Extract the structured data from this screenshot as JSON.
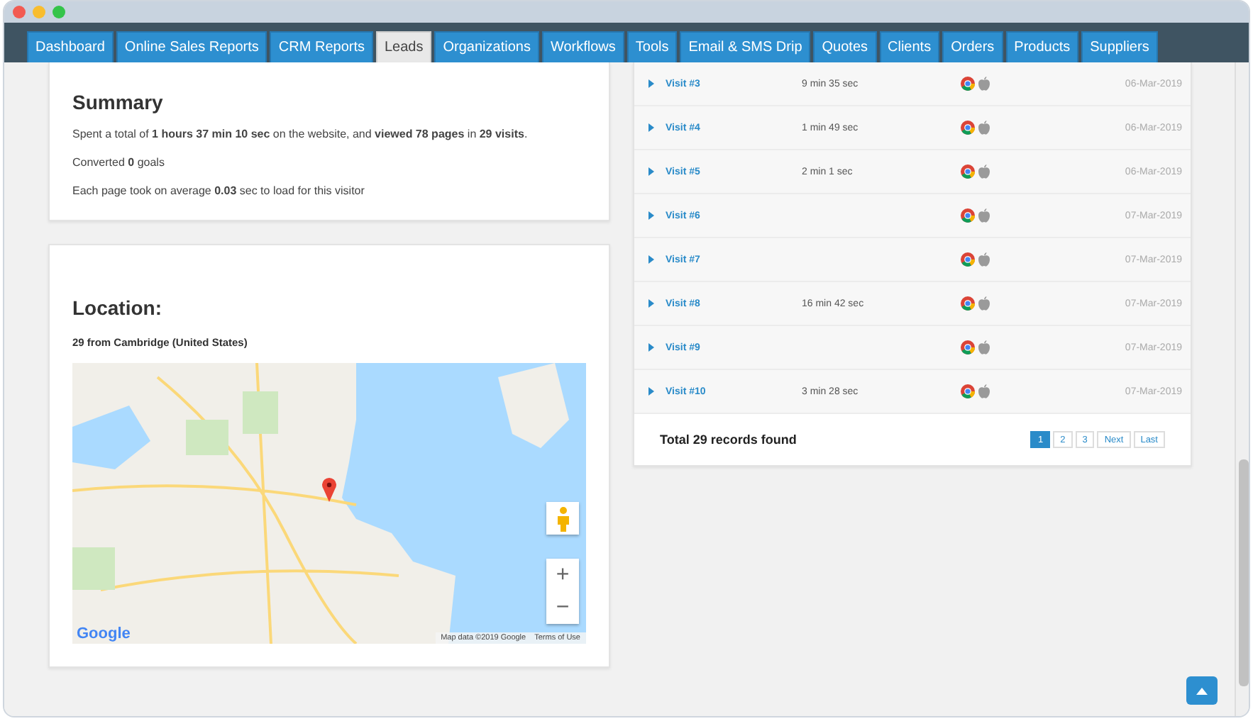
{
  "tabs": [
    {
      "label": "Dashboard",
      "selected": false
    },
    {
      "label": "Online Sales Reports",
      "selected": false
    },
    {
      "label": "CRM Reports",
      "selected": false
    },
    {
      "label": "Leads",
      "selected": true
    },
    {
      "label": "Organizations",
      "selected": false
    },
    {
      "label": "Workflows",
      "selected": false
    },
    {
      "label": "Tools",
      "selected": false
    },
    {
      "label": "Email & SMS Drip",
      "selected": false
    },
    {
      "label": "Quotes",
      "selected": false
    },
    {
      "label": "Clients",
      "selected": false
    },
    {
      "label": "Orders",
      "selected": false
    },
    {
      "label": "Products",
      "selected": false
    },
    {
      "label": "Suppliers",
      "selected": false
    }
  ],
  "summary": {
    "title": "Summary",
    "lines": [
      "Spent a total of **1 hours 37 min 10 sec** on the website, and **viewed 78 pages** in **29 visits**.",
      "Converted **0** goals",
      "Each page took on average **0.03** sec to load for this visitor"
    ]
  },
  "location": {
    "title": "Location:",
    "place": "29 from Cambridge (United States)",
    "map": {
      "logo": "Google",
      "attribution": "Map data ©2019 Google",
      "terms": "Terms of Use",
      "zoom_in": "+",
      "zoom_out": "−"
    }
  },
  "visits": {
    "rows": [
      {
        "label": "Visit #3",
        "duration": "9 min 35 sec",
        "date": "06-Mar-2019"
      },
      {
        "label": "Visit #4",
        "duration": "1 min 49 sec",
        "date": "06-Mar-2019"
      },
      {
        "label": "Visit #5",
        "duration": "2 min 1 sec",
        "date": "06-Mar-2019"
      },
      {
        "label": "Visit #6",
        "date": "07-Mar-2019"
      },
      {
        "label": "Visit #7",
        "date": "07-Mar-2019"
      },
      {
        "label": "Visit #8",
        "duration": "16 min 42 sec",
        "date": "07-Mar-2019"
      },
      {
        "label": "Visit #9",
        "date": "07-Mar-2019"
      },
      {
        "label": "Visit #10",
        "duration": "3 min 28 sec",
        "date": "07-Mar-2019"
      }
    ],
    "total": "Total 29 records found",
    "pages": [
      {
        "label": "1",
        "selected": true
      },
      {
        "label": "2",
        "selected": false
      },
      {
        "label": "3",
        "selected": false
      },
      {
        "label": "Next",
        "selected": false
      },
      {
        "label": "Last",
        "selected": false
      }
    ]
  }
}
